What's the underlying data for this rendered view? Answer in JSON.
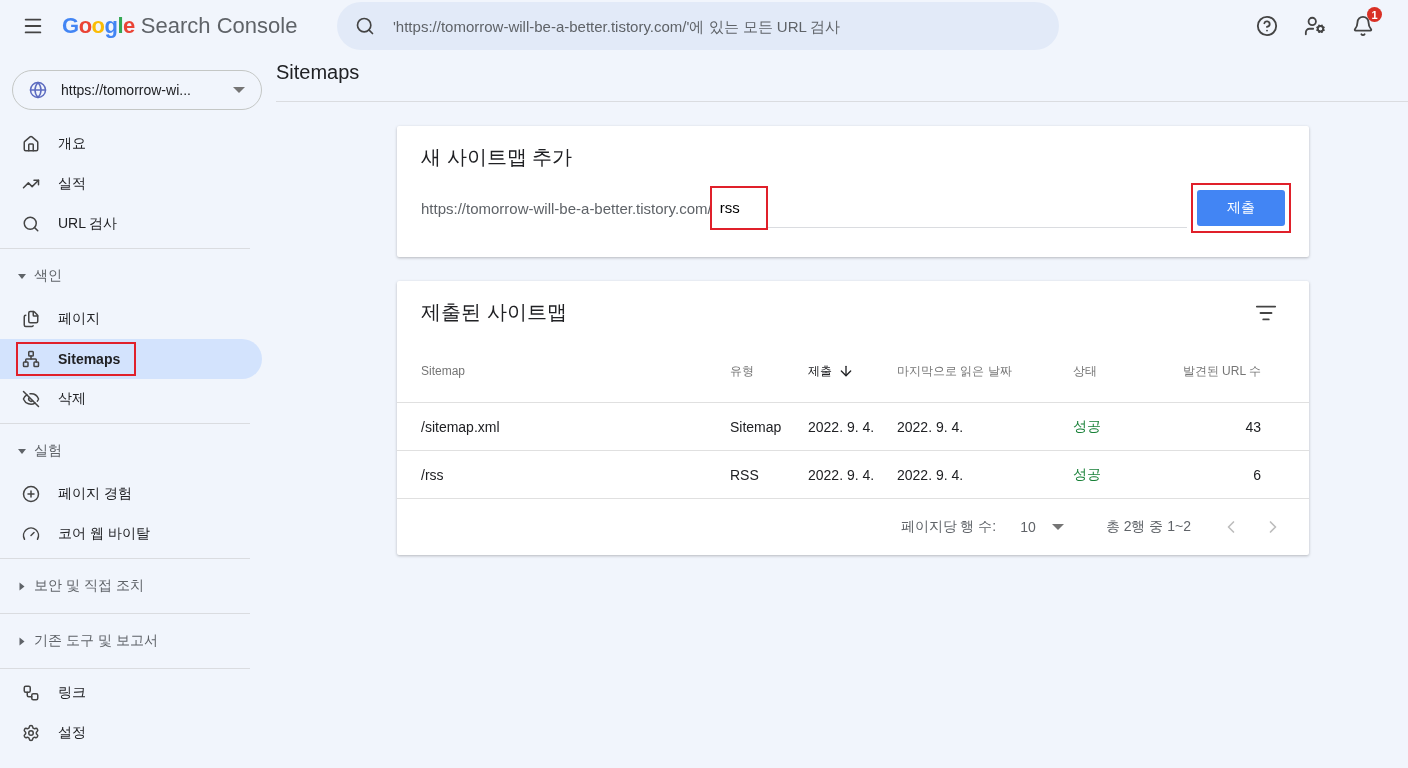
{
  "header": {
    "logo_brand": "Google",
    "logo_product": "Search Console",
    "search": {
      "placeholder": "'https://tomorrow-will-be-a-better.tistory.com/'에 있는 모든 URL 검사"
    },
    "notification_count": "1"
  },
  "sidebar": {
    "property": "https://tomorrow-wi...",
    "sections": [
      {
        "items": [
          {
            "label": "개요",
            "selected": false,
            "highlighted": false
          },
          {
            "label": "실적",
            "selected": false,
            "highlighted": false
          },
          {
            "label": "URL 검사",
            "selected": false,
            "highlighted": false
          }
        ]
      },
      {
        "heading": "색인",
        "expanded": true,
        "items": [
          {
            "label": "페이지",
            "selected": false,
            "highlighted": false
          },
          {
            "label": "Sitemaps",
            "selected": true,
            "highlighted": true
          },
          {
            "label": "삭제",
            "selected": false,
            "highlighted": false
          }
        ]
      },
      {
        "heading": "실험",
        "expanded": true,
        "items": [
          {
            "label": "페이지 경험",
            "selected": false,
            "highlighted": false
          },
          {
            "label": "코어 웹 바이탈",
            "selected": false,
            "highlighted": false
          }
        ]
      },
      {
        "heading": "보안 및 직접 조치",
        "expanded": false
      },
      {
        "heading": "기존 도구 및 보고서",
        "expanded": false
      },
      {
        "items": [
          {
            "label": "링크",
            "selected": false,
            "highlighted": false
          },
          {
            "label": "설정",
            "selected": false,
            "highlighted": false
          }
        ]
      }
    ]
  },
  "page_title": "Sitemaps",
  "add_card": {
    "title": "새 사이트맵 추가",
    "url_prefix": "https://tomorrow-will-be-a-better.tistory.com/",
    "input": {
      "value": "rss",
      "highlighted": true
    },
    "submit": {
      "label": "제출",
      "highlighted": true
    }
  },
  "submitted_card": {
    "title": "제출된 사이트맵",
    "columns": [
      {
        "label": "Sitemap",
        "sorted": false
      },
      {
        "label": "유형",
        "sorted": false
      },
      {
        "label": "제출",
        "sorted": true
      },
      {
        "label": "마지막으로 읽은 날짜",
        "sorted": false
      },
      {
        "label": "상태",
        "sorted": false
      },
      {
        "label": "발견된 URL 수",
        "sorted": false
      }
    ],
    "rows": [
      [
        "/sitemap.xml",
        "Sitemap",
        "2022. 9. 4.",
        "2022. 9. 4.",
        "성공",
        "43"
      ],
      [
        "/rss",
        "RSS",
        "2022. 9. 4.",
        "2022. 9. 4.",
        "성공",
        "6"
      ]
    ],
    "pagination": {
      "rows_per_page_label": "페이지당 행 수:",
      "rows_per_page": "10",
      "range": "총 2행 중 1~2",
      "prev_disabled": true,
      "next_disabled": true
    }
  }
}
